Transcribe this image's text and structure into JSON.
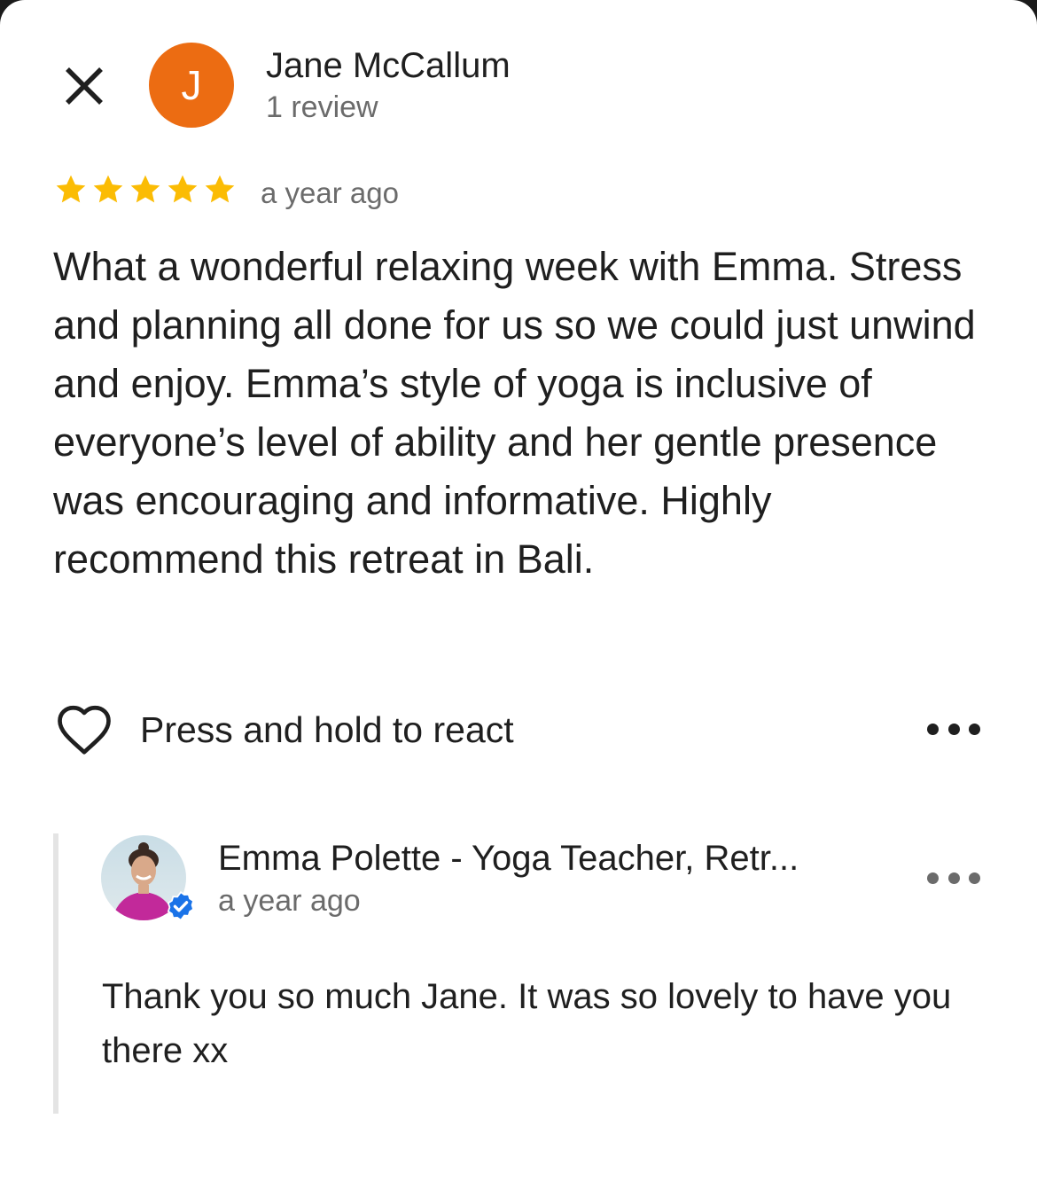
{
  "review": {
    "reviewer_initial": "J",
    "reviewer_name": "Jane McCallum",
    "review_count": "1 review",
    "rating": 5,
    "rating_max": 5,
    "time": "a year ago",
    "text": "What a wonderful relaxing week with Emma. Stress and planning all done for us so we could just unwind and enjoy. Emma’s style of yoga is inclusive of everyone’s level of ability and her gentle presence was encouraging and informative. Highly recommend this retreat in Bali."
  },
  "actions": {
    "react_label": "Press and hold to react"
  },
  "owner_reply": {
    "name": "Emma Polette - Yoga Teacher, Retr...",
    "time": "a year ago",
    "text": "Thank you so much Jane. It was so lovely to have you there xx"
  },
  "colors": {
    "avatar_bg": "#ec6c12",
    "star": "#fbbc04",
    "verified": "#1a73e8"
  },
  "icons": {
    "close": "close-icon",
    "star": "star-icon",
    "heart": "heart-outline-icon",
    "more": "more-horizontal-icon",
    "verified": "verified-badge-icon"
  }
}
